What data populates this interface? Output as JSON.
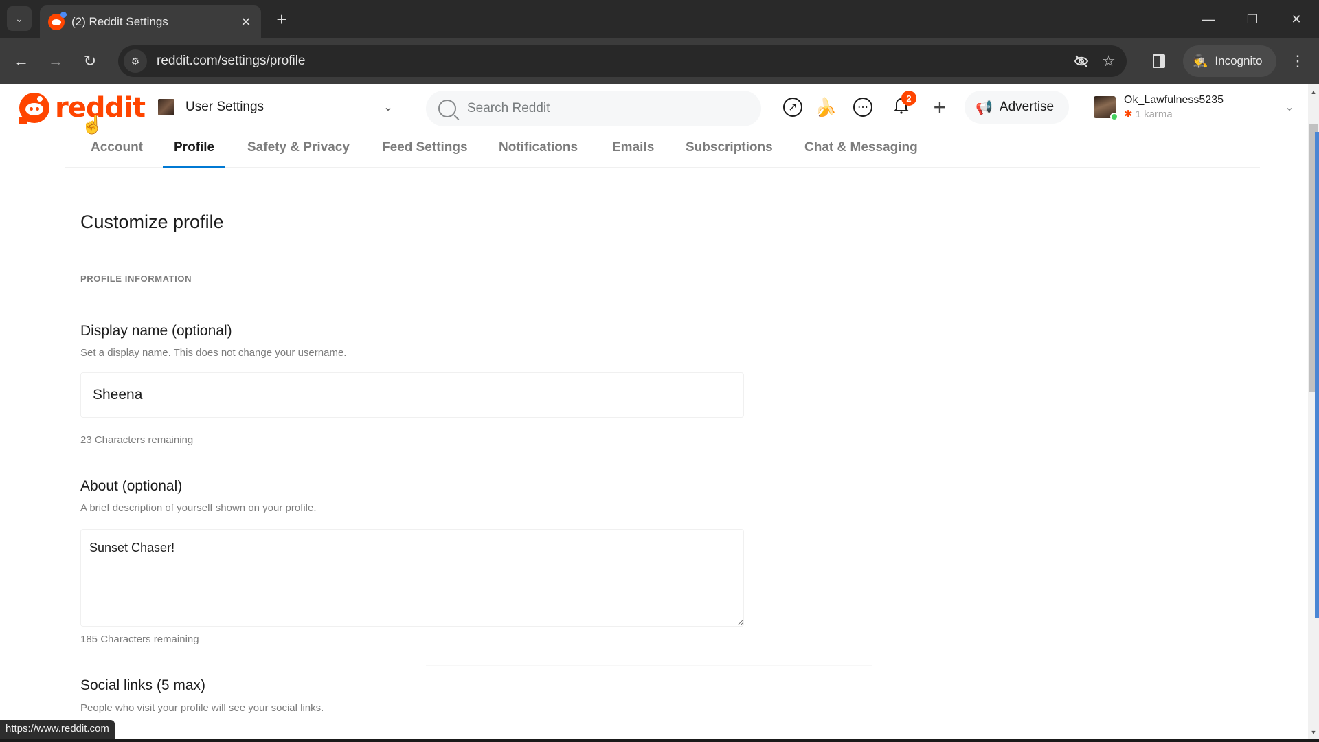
{
  "browser": {
    "tab": {
      "title": "(2) Reddit Settings",
      "favicon": "reddit-favicon",
      "close_icon": "close-icon"
    },
    "new_tab_label": "+",
    "window_controls": {
      "minimize": "—",
      "restore": "❐",
      "close": "✕"
    },
    "nav": {
      "back": "←",
      "forward": "→",
      "reload": "↻"
    },
    "address": {
      "url": "reddit.com/settings/profile",
      "site_info_icon": "tune-icon"
    },
    "omnibox_icons": {
      "eye_off": "eye-off-icon",
      "bookmark": "☆"
    },
    "incognito_label": "Incognito",
    "menu": "⋮",
    "status_url": "https://www.reddit.com"
  },
  "reddit": {
    "brand_color": "#ff4500",
    "wordmark": "reddit",
    "community_select": {
      "label": "User Settings",
      "chevron": "⌄"
    },
    "search": {
      "placeholder": "Search Reddit"
    },
    "header_icons": {
      "popular": "↗",
      "premium": "🍌",
      "chat": "⋯",
      "notifications": "🔔",
      "create": "+"
    },
    "notification_count": "2",
    "advertise_label": "Advertise",
    "user": {
      "name": "Ok_Lawfulness5235",
      "karma": "1 karma",
      "status": "online"
    }
  },
  "settings": {
    "tabs": [
      {
        "label": "Account",
        "active": false
      },
      {
        "label": "Profile",
        "active": true
      },
      {
        "label": "Safety & Privacy",
        "active": false
      },
      {
        "label": "Feed Settings",
        "active": false
      },
      {
        "label": "Notifications",
        "active": false
      },
      {
        "label": "Emails",
        "active": false
      },
      {
        "label": "Subscriptions",
        "active": false
      },
      {
        "label": "Chat & Messaging",
        "active": false
      }
    ],
    "page_title": "Customize profile",
    "section_label": "PROFILE INFORMATION",
    "display_name": {
      "title": "Display name (optional)",
      "description": "Set a display name. This does not change your username.",
      "value": "Sheena",
      "remaining": "23 Characters remaining"
    },
    "about": {
      "title": "About (optional)",
      "description": "A brief description of yourself shown on your profile.",
      "value": "Sunset Chaser!",
      "remaining": "185 Characters remaining"
    },
    "social_links": {
      "title": "Social links (5 max)",
      "description": "People who visit your profile will see your social links."
    }
  }
}
